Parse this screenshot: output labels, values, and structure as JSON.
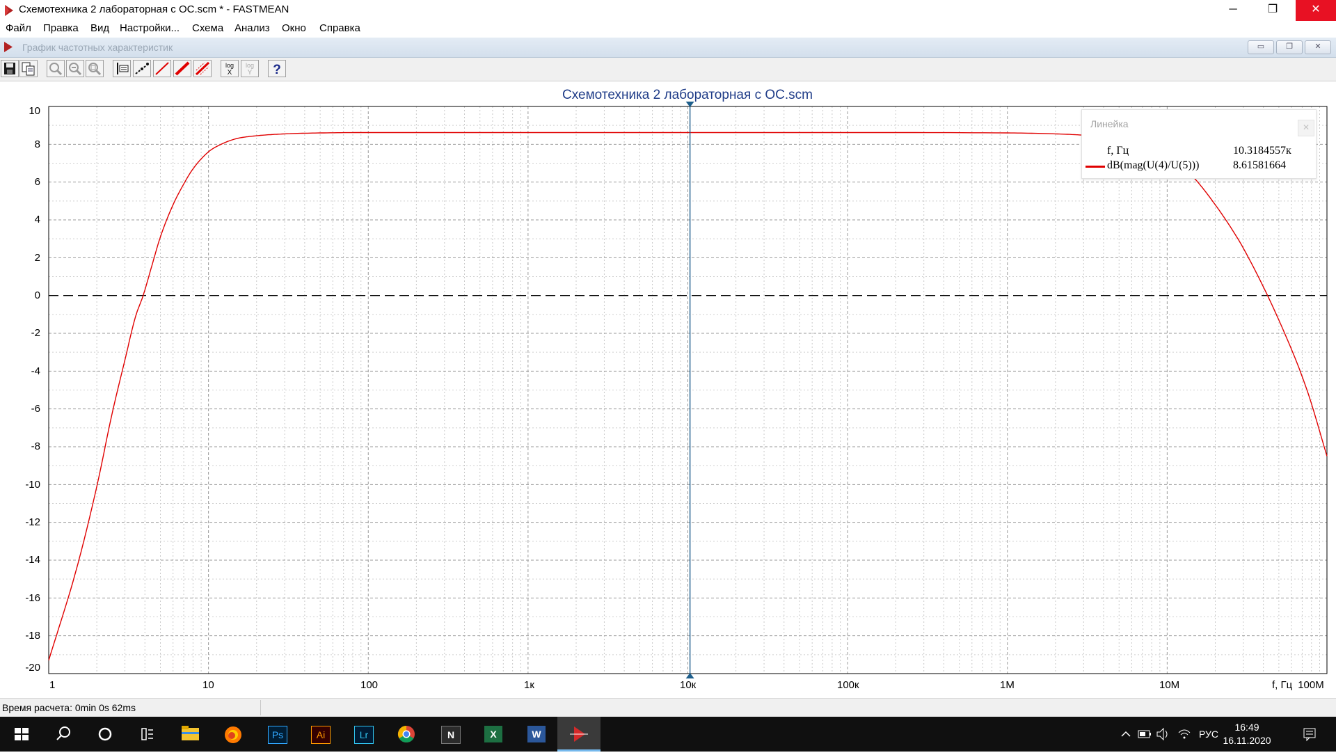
{
  "window": {
    "title": "Схемотехника 2 лабораторная с ОС.scm * - FASTMEAN",
    "minimize_glyph": "─",
    "restore_glyph": "❐",
    "close_glyph": "✕"
  },
  "menu": [
    {
      "label": "Файл"
    },
    {
      "label": "Правка"
    },
    {
      "label": "Вид"
    },
    {
      "label": "Настройки..."
    },
    {
      "label": "Схема"
    },
    {
      "label": "Анализ"
    },
    {
      "label": "Окно"
    },
    {
      "label": "Справка"
    }
  ],
  "child_window": {
    "title": "График частотных характеристик",
    "icon": "fastmean-app-icon"
  },
  "toolbar": {
    "buttons": [
      {
        "icon": "save-icon"
      },
      {
        "icon": "copy-icon"
      },
      {
        "icon": "zoom-icon"
      },
      {
        "icon": "zoom-out-icon"
      },
      {
        "icon": "zoom-fit-icon"
      },
      {
        "icon": "ruler-icon"
      },
      {
        "icon": "dotted-line-icon"
      },
      {
        "icon": "line-icon"
      },
      {
        "icon": "bold-line-icon"
      },
      {
        "icon": "grid-line-icon"
      },
      {
        "icon": "log-x-icon",
        "text": "log X"
      },
      {
        "icon": "log-y-icon",
        "text": "log Y"
      },
      {
        "icon": "help-icon",
        "text": "?"
      }
    ]
  },
  "chart_data": {
    "type": "line",
    "title": "Схемотехника 2 лабораторная с ОС.scm",
    "xlabel": "f, Гц",
    "x_scale": "log",
    "xlim": [
      1,
      100000000
    ],
    "ylim": [
      -20,
      10
    ],
    "x_ticks": [
      "1",
      "10",
      "100",
      "1к",
      "10к",
      "100к",
      "1M",
      "10M",
      "100M"
    ],
    "y_ticks": [
      "10",
      "8",
      "6",
      "4",
      "2",
      "0",
      "-2",
      "-4",
      "-6",
      "-8",
      "-10",
      "-12",
      "-14",
      "-16",
      "-18",
      "-20"
    ],
    "grid": true,
    "reference_line_y": 0,
    "cursor_x": 10318.4557,
    "series": [
      {
        "name": "dB(mag(U(4)/U(5)))",
        "color": "#e00000",
        "x": [
          1,
          1.5,
          2,
          2.5,
          3,
          3.5,
          3.9,
          4.5,
          5,
          6,
          7,
          8,
          10,
          12,
          15,
          20,
          30,
          50,
          100,
          1000,
          10000,
          100000,
          1000000,
          2000000,
          3000000,
          5000000,
          8000000,
          10000000,
          12000000,
          15000000,
          20000000,
          25000000,
          30000000,
          50000000,
          75000000,
          100000000
        ],
        "y": [
          -19.3,
          -14.4,
          -10.1,
          -6.2,
          -3.4,
          -1.1,
          0.0,
          1.8,
          3.1,
          4.8,
          5.9,
          6.7,
          7.6,
          8.0,
          8.3,
          8.45,
          8.55,
          8.6,
          8.62,
          8.62,
          8.62,
          8.62,
          8.6,
          8.55,
          8.48,
          8.3,
          7.8,
          7.4,
          6.95,
          6.15,
          4.8,
          3.6,
          2.5,
          -1.3,
          -5.0,
          -8.5
        ]
      }
    ]
  },
  "ruler": {
    "title": "Линейка",
    "close_glyph": "✕",
    "freq_label": "f, Гц",
    "freq_value": "10.3184557к",
    "series_label": "dB(mag(U(4)/U(5)))",
    "series_value": "8.61581664"
  },
  "status": {
    "calc_time": "Время расчета: 0min 0s 62ms"
  },
  "taskbar": {
    "apps": [
      {
        "icon": "windows-start-icon"
      },
      {
        "icon": "search-icon"
      },
      {
        "icon": "cortana-icon"
      },
      {
        "icon": "task-view-icon"
      },
      {
        "icon": "file-explorer-icon"
      },
      {
        "icon": "firefox-icon"
      },
      {
        "icon": "photoshop-icon",
        "text": "Ps"
      },
      {
        "icon": "illustrator-icon",
        "text": "Ai"
      },
      {
        "icon": "lightroom-icon",
        "text": "Lr"
      },
      {
        "icon": "chrome-icon"
      },
      {
        "icon": "notion-icon",
        "text": "N"
      },
      {
        "icon": "excel-icon",
        "text": "X"
      },
      {
        "icon": "word-icon",
        "text": "W"
      },
      {
        "icon": "fastmean-icon"
      }
    ],
    "tray": {
      "language": "РУС",
      "time": "16:49",
      "date": "16.11.2020"
    }
  }
}
